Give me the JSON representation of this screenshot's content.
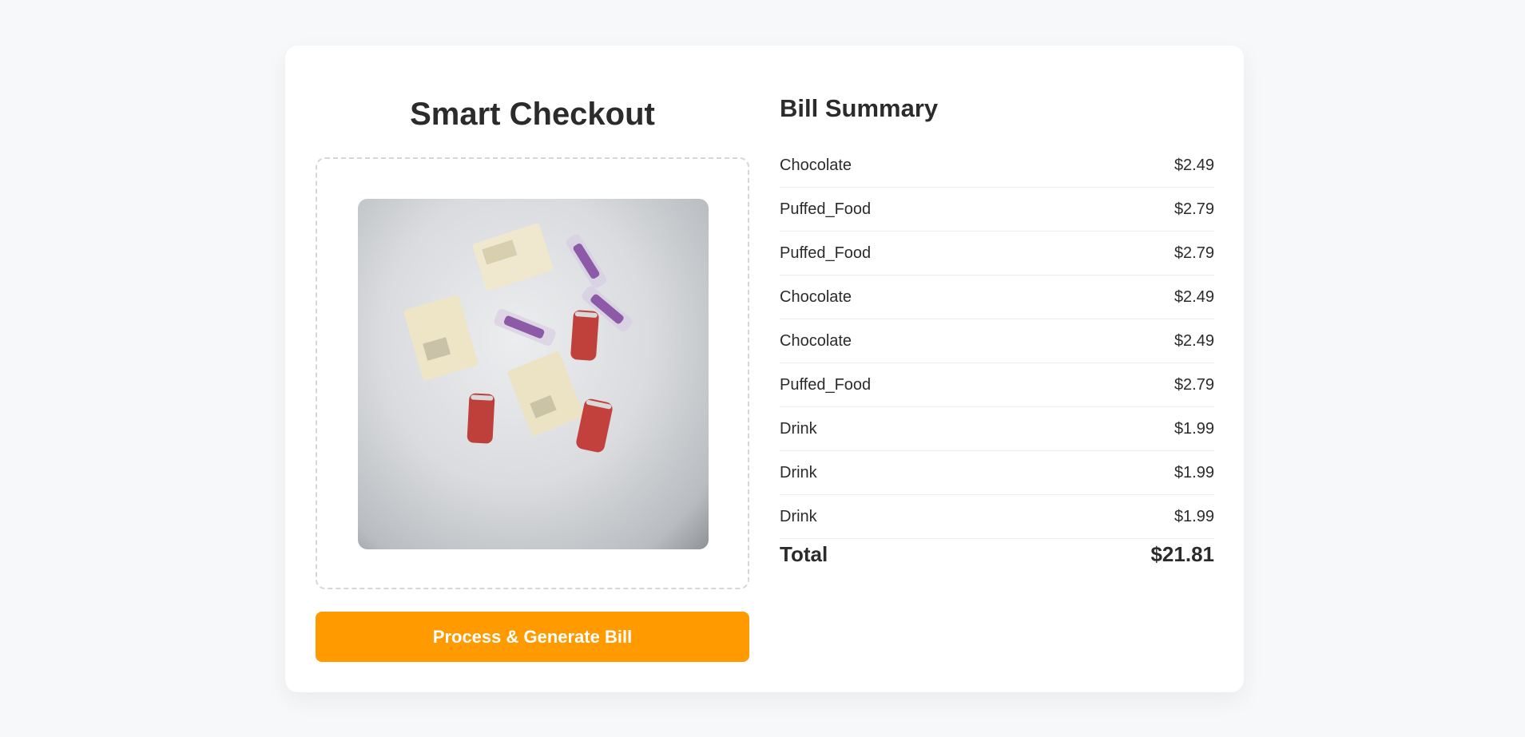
{
  "checkout": {
    "title": "Smart Checkout",
    "image_alt": "Photo of checkout items",
    "process_button_label": "Process & Generate Bill"
  },
  "bill": {
    "title": "Bill Summary",
    "items": [
      {
        "name": "Chocolate",
        "price": "$2.49"
      },
      {
        "name": "Puffed_Food",
        "price": "$2.79"
      },
      {
        "name": "Puffed_Food",
        "price": "$2.79"
      },
      {
        "name": "Chocolate",
        "price": "$2.49"
      },
      {
        "name": "Chocolate",
        "price": "$2.49"
      },
      {
        "name": "Puffed_Food",
        "price": "$2.79"
      },
      {
        "name": "Drink",
        "price": "$1.99"
      },
      {
        "name": "Drink",
        "price": "$1.99"
      },
      {
        "name": "Drink",
        "price": "$1.99"
      }
    ],
    "total_label": "Total",
    "total_value": "$21.81"
  },
  "colors": {
    "accent": "#ff9a00",
    "background": "#f7f8fa",
    "card": "#ffffff",
    "text": "#2b2b2b"
  }
}
